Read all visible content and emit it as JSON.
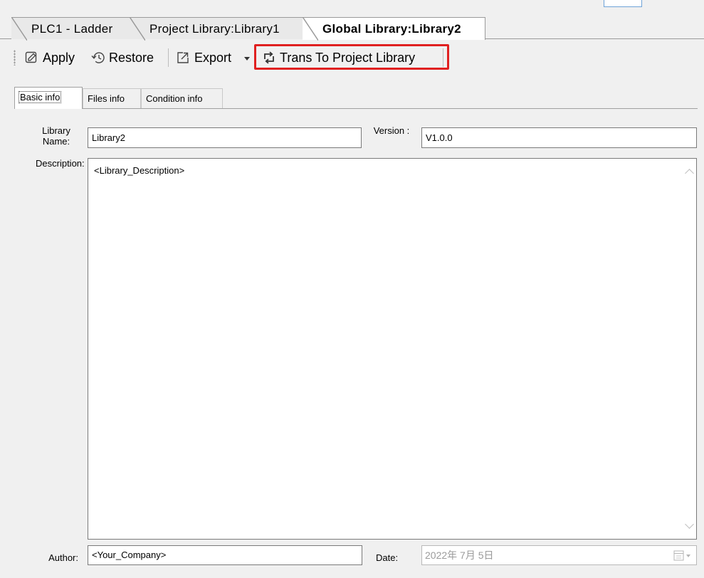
{
  "document_tabs": [
    {
      "label": "PLC1 - Ladder"
    },
    {
      "label": "Project Library:Library1"
    },
    {
      "label": "Global Library:Library2",
      "active": true
    }
  ],
  "toolbar": {
    "apply_label": "Apply",
    "restore_label": "Restore",
    "export_label": "Export",
    "trans_label": "Trans To Project Library",
    "highlight_color": "#e02020"
  },
  "inner_tabs": [
    {
      "label": "Basic info",
      "active": true
    },
    {
      "label": "Files info"
    },
    {
      "label": "Condition info"
    }
  ],
  "form": {
    "library_name_label": "Library Name:",
    "library_name_value": "Library2",
    "version_label": "Version :",
    "version_value": "V1.0.0",
    "description_label": "Description:",
    "description_value": "<Library_Description>",
    "author_label": "Author:",
    "author_value": "<Your_Company>",
    "date_label": "Date:",
    "date_value": "2022年 7月 5日"
  }
}
